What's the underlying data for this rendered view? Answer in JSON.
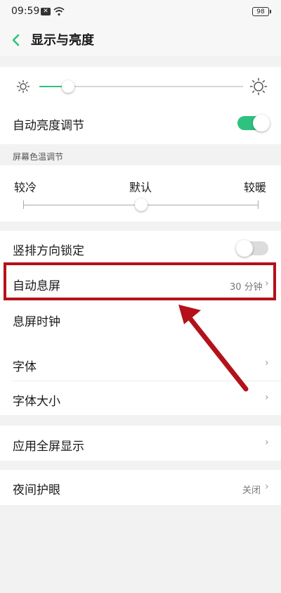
{
  "status_bar": {
    "time": "09:59",
    "battery": "98"
  },
  "header": {
    "title": "显示与亮度"
  },
  "brightness": {
    "level": 0.14
  },
  "auto_brightness": {
    "label": "自动亮度调节",
    "enabled": true
  },
  "color_temp": {
    "section_title": "屏幕色温调节",
    "cool_label": "较冷",
    "default_label": "默认",
    "warm_label": "较暖",
    "level": 0.5
  },
  "rows": {
    "portrait_lock": {
      "label": "竖排方向锁定",
      "enabled": false
    },
    "auto_screen_off": {
      "label": "自动息屏",
      "value": "30 分钟"
    },
    "screen_off_clock": {
      "label": "息屏时钟"
    },
    "font": {
      "label": "字体"
    },
    "font_size": {
      "label": "字体大小"
    },
    "fullscreen_apps": {
      "label": "应用全屏显示"
    },
    "night_mode": {
      "label": "夜间护眼",
      "value": "关闭"
    }
  },
  "colors": {
    "accent": "#2ec27e",
    "annotation": "#b3121a"
  }
}
